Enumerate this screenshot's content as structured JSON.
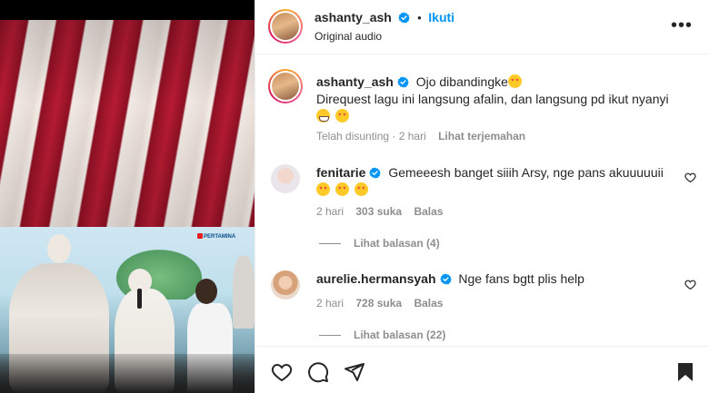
{
  "header": {
    "username": "ashanty_ash",
    "separator": "•",
    "follow_label": "Ikuti",
    "audio_label": "Original audio",
    "more_label": "•••"
  },
  "caption": {
    "username": "ashanty_ash",
    "line1": "Ojo dibandingke",
    "line2": "Direquest lagu ini langsung afalin, dan langsung pd ikut nyanyi",
    "edited": "Telah disunting · 2 hari",
    "translate": "Lihat terjemahan"
  },
  "comments": [
    {
      "username": "fenitarie",
      "text": "Gemeeesh banget siiih Arsy, nge pans akuuuuuii",
      "time": "2 hari",
      "likes": "303 suka",
      "reply": "Balas",
      "view_replies": "Lihat balasan (4)"
    },
    {
      "username": "aurelie.hermansyah",
      "text": "Nge fans bgtt plis help",
      "time": "2 hari",
      "likes": "728 suka",
      "reply": "Balas",
      "view_replies": "Lihat balasan (22)"
    }
  ],
  "media": {
    "brand_text": "PERTAMINA"
  },
  "colors": {
    "accent": "#0095f6",
    "verified": "#0095f6",
    "muted": "#8e8e8e",
    "text": "#262626"
  },
  "icons": {
    "like": "heart-icon",
    "comment": "comment-bubble-icon",
    "share": "paper-plane-icon",
    "save": "bookmark-icon",
    "more": "more-options-icon"
  }
}
